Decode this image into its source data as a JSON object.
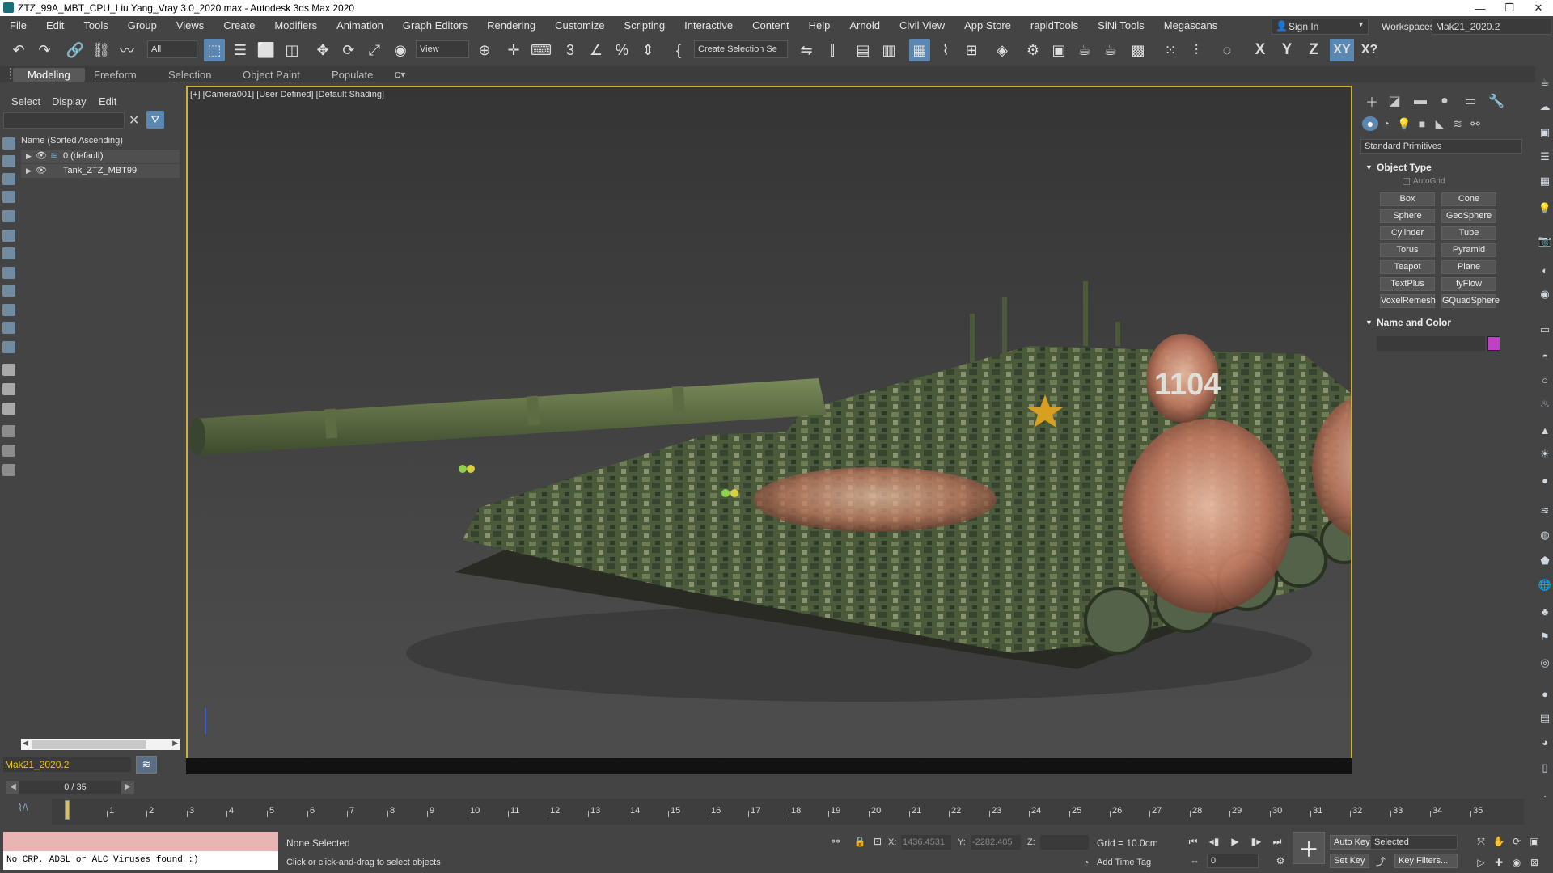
{
  "window": {
    "title": "ZTZ_99A_MBT_CPU_Liu Yang_Vray 3.0_2020.max - Autodesk 3ds Max 2020",
    "controls": [
      "—",
      "❐",
      "✕"
    ]
  },
  "menu": {
    "items": [
      "File",
      "Edit",
      "Tools",
      "Group",
      "Views",
      "Create",
      "Modifiers",
      "Animation",
      "Graph Editors",
      "Rendering",
      "Customize",
      "Scripting",
      "Interactive",
      "Content",
      "Help",
      "Arnold",
      "Civil View",
      "App Store",
      "rapidTools",
      "SiNi Tools",
      "Megascans"
    ],
    "sign_in": "Sign In",
    "workspaces_label": "Workspaces:",
    "workspace_value": "Mak21_2020.2"
  },
  "toolbar": {
    "filter_value": "All",
    "ref_coord_value": "View",
    "selection_set_placeholder": "Create Selection Se",
    "axis_labels": [
      "X",
      "Y",
      "Z",
      "XY",
      "X?"
    ]
  },
  "ribbon": {
    "tabs": [
      "Modeling",
      "Freeform",
      "Selection",
      "Object Paint",
      "Populate"
    ]
  },
  "scene_explorer": {
    "menu": [
      "Select",
      "Display",
      "Edit"
    ],
    "column_header": "Name (Sorted Ascending)",
    "rows": [
      {
        "label": "0 (default)"
      },
      {
        "label": "Tank_ZTZ_MBT99"
      }
    ],
    "layer_value": "Mak21_2020.2"
  },
  "viewport": {
    "label": "[+] [Camera001] [User Defined] [Default Shading]",
    "turret_marking": "1104"
  },
  "command_panel": {
    "category": "Standard Primitives",
    "object_type_title": "Object Type",
    "autogrid_label": "AutoGrid",
    "buttons": [
      "Box",
      "Cone",
      "Sphere",
      "GeoSphere",
      "Cylinder",
      "Tube",
      "Torus",
      "Pyramid",
      "Teapot",
      "Plane",
      "TextPlus",
      "tyFlow",
      "VoxelRemesh",
      "GQuadSphere"
    ],
    "name_color_title": "Name and Color",
    "object_color": "#c040c8"
  },
  "timeline": {
    "slider_label": "0 / 35",
    "ticks": [
      "0",
      "1",
      "2",
      "3",
      "4",
      "5",
      "6",
      "7",
      "8",
      "9",
      "10",
      "11",
      "12",
      "13",
      "14",
      "15",
      "16",
      "17",
      "18",
      "19",
      "20",
      "21",
      "22",
      "23",
      "24",
      "25",
      "26",
      "27",
      "28",
      "29",
      "30",
      "31",
      "32",
      "33",
      "34",
      "35"
    ]
  },
  "status": {
    "script_output": "No CRP, ADSL or ALC Viruses found :)",
    "selection": "None Selected",
    "prompt": "Click or click-and-drag to select objects",
    "x_label": "X:",
    "x_value": "1436.4531",
    "y_label": "Y:",
    "y_value": "-2282.405",
    "z_label": "Z:",
    "z_value": "",
    "grid": "Grid = 10.0cm",
    "add_time_tag": "Add Time Tag",
    "auto_key": "Auto Key",
    "set_key": "Set Key",
    "key_mode": "Selected",
    "key_filters": "Key Filters...",
    "frame_value": "0"
  },
  "colors": {
    "accent": "#5b87b3",
    "viewport_border": "#c9b13b",
    "layer_text": "#f2c40e"
  }
}
